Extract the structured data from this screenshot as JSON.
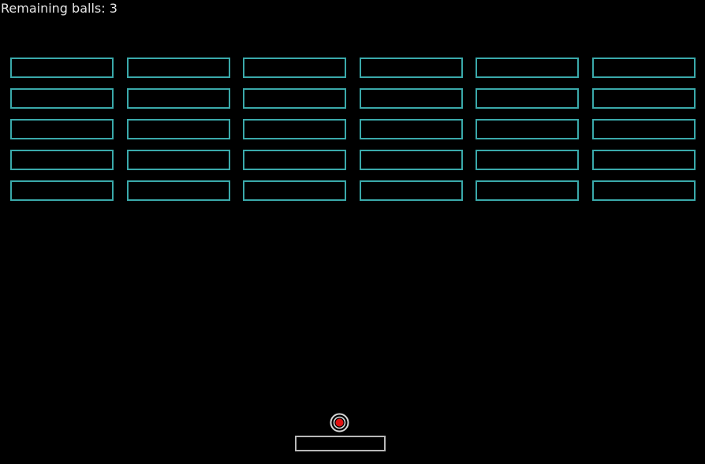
{
  "hud": {
    "remaining_balls_label": "Remaining balls: 3",
    "remaining_balls": 3
  },
  "bricks": {
    "rows": 5,
    "columns": 6,
    "intact": 30,
    "outline_color": "#3aa9aa"
  },
  "paddle": {
    "outline_color": "#b8b8b8"
  },
  "ball": {
    "core_color": "#e01010",
    "ring_color": "#d8d8d8"
  },
  "colors": {
    "background": "#000000",
    "text": "#e6e6e6"
  }
}
